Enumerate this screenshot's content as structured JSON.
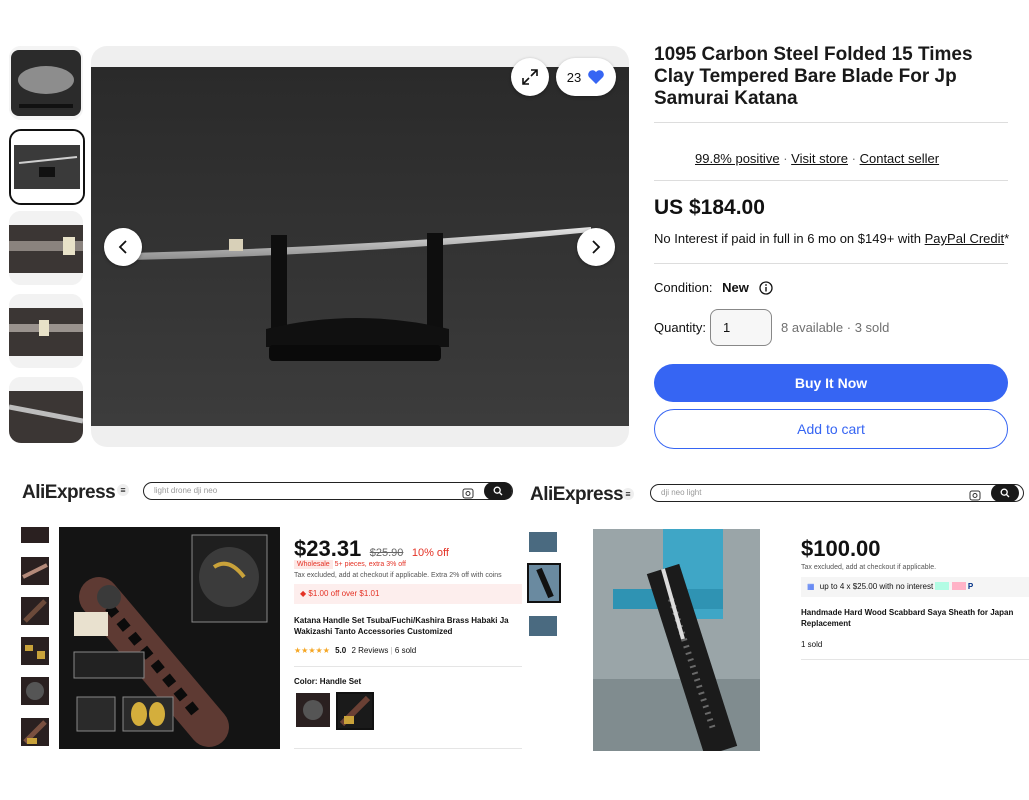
{
  "ebay": {
    "favorites_count": "23",
    "title": "1095 Carbon Steel Folded 15 Times Clay Tempered Bare Blade For Jp Samurai Katana",
    "seller": {
      "positive": "99.8% positive",
      "visit_store": "Visit store",
      "contact": "Contact seller",
      "separator": "·"
    },
    "price": "US $184.00",
    "financing": {
      "text": "No Interest if paid in full in 6 mo on $149+ with ",
      "link": "PayPal Credit",
      "suffix": "*"
    },
    "condition_label": "Condition:",
    "condition_value": "New",
    "quantity_label": "Quantity:",
    "quantity_value": "1",
    "availability": "8 available · 3 sold",
    "buy_now": "Buy It Now",
    "add_to_cart": "Add to cart",
    "colors": {
      "primary": "#3665f3",
      "heart": "#3665f3"
    }
  },
  "ali1": {
    "logo": "AliExpress",
    "search_placeholder": "light drone dji neo",
    "price": "$23.31",
    "old_price": "$25.90",
    "discount": "10% off",
    "wholesale_badge": "Wholesale",
    "wholesale_note": "5+ pieces, extra 3% off",
    "tax_note": "Tax excluded, add at checkout if applicable. Extra 2% off with coins",
    "coupon": "$1.00 off over $1.01",
    "title_line1": "Katana Handle Set Tsuba/Fuchi/Kashira Brass Habaki Ja",
    "title_line2": "Wakizashi Tanto Accessories Customized",
    "rating": "5.0",
    "reviews": "2 Reviews",
    "sold": "6 sold",
    "color_label": "Color:",
    "color_value": "Handle Set",
    "colors": {
      "accent": "#e43225"
    }
  },
  "ali2": {
    "logo": "AliExpress",
    "search_placeholder": "dji neo light",
    "price": "$100.00",
    "tax_note": "Tax excluded, add at checkout if applicable.",
    "installments": "up to 4 x $25.00 with no interest",
    "title_line1": "Handmade Hard Wood Scabbard Saya Sheath for Japan",
    "title_line2": "Replacement",
    "sold": "1 sold"
  }
}
